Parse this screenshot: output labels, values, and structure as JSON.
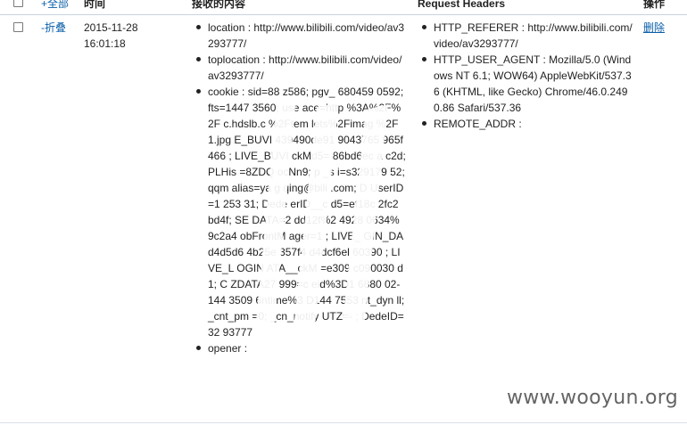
{
  "header": {
    "select_all": "+全部",
    "time": "时间",
    "content": "接收的内容",
    "request_headers": "Request Headers",
    "actions": "操作"
  },
  "row": {
    "toggle": "-折叠",
    "date": "2015-11-28",
    "time": "16:01:18",
    "content": [
      "location : http://www.bilibili.com/video/av3293777/",
      "toplocation : http://www.bilibili.com/video/av3293777/",
      "cookie : sid=88  z586; pgv_  680459 0592; fts=1447  3560; use  ace=http %3A%2F%2F  c.hdslb.c  %2Ftem lets%2Fimag  %2F1.jpg  E_BUVI 439490de91  9043765  965f466 ; LIVE_BUVI  ckMd5=  86bd6ec  a c2d; PLHis  =8ZDQ  ocNn9; p  _s i=s329179  52; qqm  alias=ya  g qing@bili  .com; D  UserID=1  253 31; Dede  erID__c  d5=ef18c  2fc2 bd4f; SE  DATA=2  dd12f%2  4928 0634%  9c2a4  obFrontM  ager=1 ; LIVE_  GIN_DA  d4d5d6  4b25e 357f4  d4dcf6el  60390  ; LIVE_L OGIN  ATA__ckM  =e309  c090030 d1; C  ZDATA27  999=c  eid%3D1 6880  02-144  3509  6ntime%3 D144  7553  nt_dyn  ll; _cnt_pm =0; _cn_notify  UTZ=-  ; DedeID=32 93777",
      "opener :"
    ],
    "headers": [
      "HTTP_REFERER : http://www.bilibili.com/video/av3293777/",
      "HTTP_USER_AGENT : Mozilla/5.0 (Windows NT 6.1; WOW64) AppleWebKit/537.36 (KHTML, like Gecko) Chrome/46.0.2490.86 Safari/537.36",
      "REMOTE_ADDR :"
    ],
    "delete": "删除"
  },
  "watermark": "www.wooyun.org",
  "colors": {
    "link": "#0b5fa8",
    "text": "#222222",
    "border": "#c8d4e0"
  }
}
